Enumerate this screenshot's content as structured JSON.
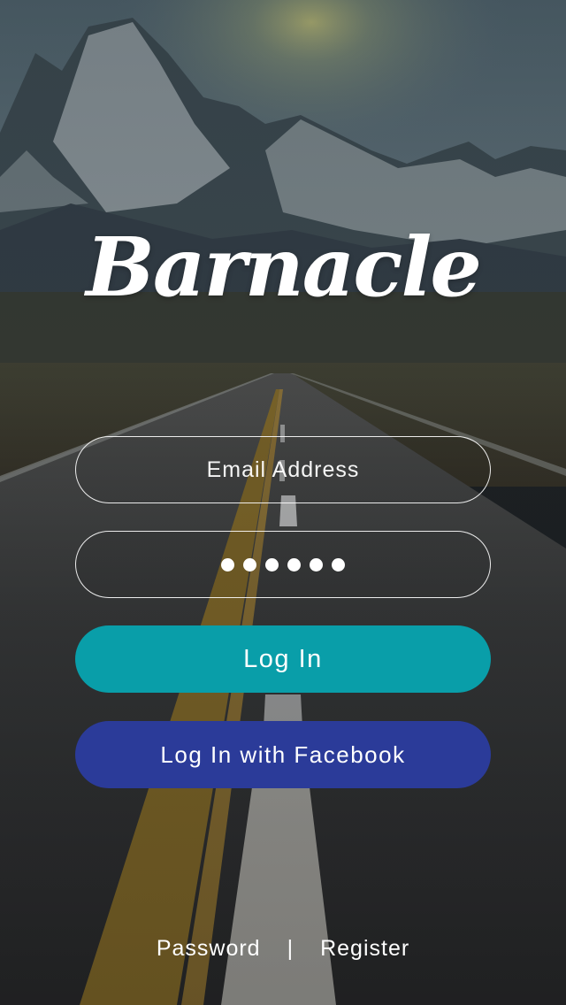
{
  "app": {
    "logo_text": "Barnacle"
  },
  "form": {
    "email_placeholder": "Email Address",
    "email_value": "",
    "password_mask_count": 6
  },
  "buttons": {
    "login_label": "Log In",
    "facebook_label": "Log In with Facebook"
  },
  "footer": {
    "password_link": "Password",
    "separator": "|",
    "register_link": "Register"
  },
  "colors": {
    "login_button": "#099ea9",
    "facebook_button": "#2b3b99",
    "field_border": "#ffffff",
    "text": "#ffffff"
  },
  "background": {
    "description_icon": "mountain-road-photo"
  }
}
